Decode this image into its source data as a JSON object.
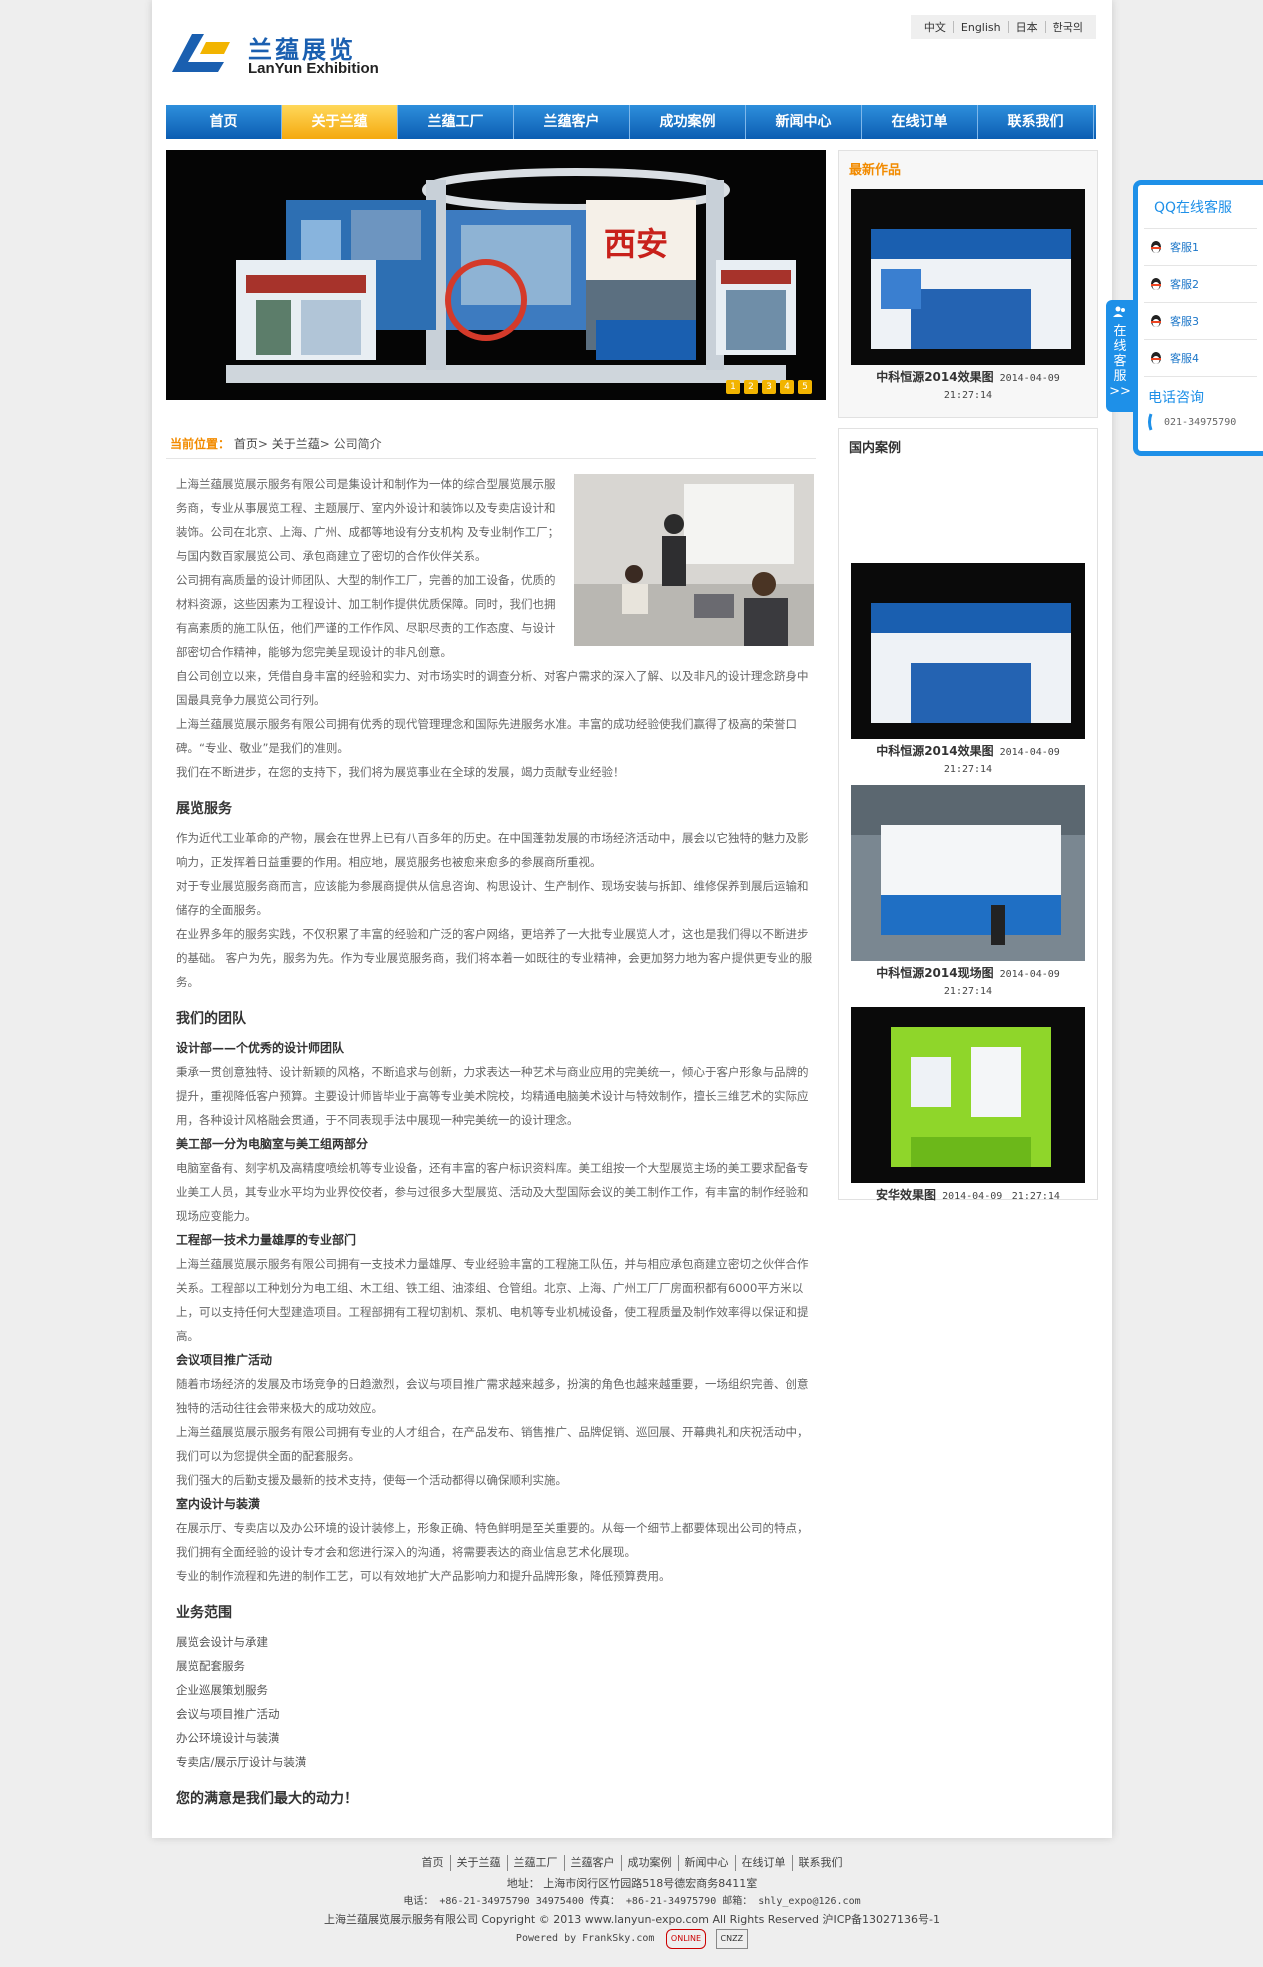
{
  "header": {
    "logo_cn": "兰蕴展览",
    "logo_en": "LanYun Exhibition",
    "languages": [
      "中文",
      "English",
      "日本",
      "한국의"
    ]
  },
  "nav": [
    "首页",
    "关于兰蕴",
    "兰蕴工厂",
    "兰蕴客户",
    "成功案例",
    "新闻中心",
    "在线订单",
    "联系我们"
  ],
  "banner": {
    "dots": [
      "1",
      "2",
      "3",
      "4",
      "5"
    ],
    "sign": "西安"
  },
  "latest": {
    "title": "最新作品",
    "item": {
      "name": "中科恒源2014效果图",
      "date": "2014-04-09",
      "time": "21:27:14"
    }
  },
  "domestic": {
    "title": "国内案例",
    "items": [
      {
        "name": "中科恒源2014效果图",
        "date": "2014-04-09",
        "time": "21:27:14"
      },
      {
        "name": "中科恒源2014现场图",
        "date": "2014-04-09",
        "time": "21:27:14"
      },
      {
        "name": "安华效果图",
        "date": "2014-04-09",
        "time": "21:27:14"
      }
    ]
  },
  "breadcrumb": {
    "label": "当前位置：",
    "items": [
      "首页",
      "关于兰蕴",
      "公司简介"
    ]
  },
  "content": {
    "intro": [
      "上海兰蕴展览展示服务有限公司是集设计和制作为一体的综合型展览展示服务商，专业从事展览工程、主题展厅、室内外设计和装饰以及专卖店设计和装饰。公司在北京、上海、广州、成都等地设有分支机构 及专业制作工厂；与国内数百家展览公司、承包商建立了密切的合作伙伴关系。",
      "公司拥有高质量的设计师团队、大型的制作工厂，完善的加工设备，优质的材料资源，这些因素为工程设计、加工制作提供优质保障。同时，我们也拥有高素质的施工队伍，他们严谨的工作作风、尽职尽责的工作态度、与设计部密切合作精神，能够为您完美呈现设计的非凡创意。",
      "自公司创立以来，凭借自身丰富的经验和实力、对市场实时的调查分析、对客户需求的深入了解、以及非凡的设计理念跻身中国最具竞争力展览公司行列。",
      "上海兰蕴展览展示服务有限公司拥有优秀的现代管理理念和国际先进服务水准。丰富的成功经验使我们赢得了极高的荣誉口碑。“专业、敬业”是我们的准则。",
      "我们在不断进步，在您的支持下，我们将为展览事业在全球的发展，竭力贡献专业经验！"
    ],
    "service_title": "展览服务",
    "service": [
      "作为近代工业革命的产物，展会在世界上已有八百多年的历史。在中国蓬勃发展的市场经济活动中，展会以它独特的魅力及影响力，正发挥着日益重要的作用。相应地，展览服务也被愈来愈多的参展商所重视。",
      "对于专业展览服务商而言，应该能为参展商提供从信息咨询、构思设计、生产制作、现场安装与拆卸、维修保养到展后运输和储存的全面服务。",
      "在业界多年的服务实践，不仅积累了丰富的经验和广泛的客户网络，更培养了一大批专业展览人才，这也是我们得以不断进步的基础。 客户为先，服务为先。作为专业展览服务商，我们将本着一如既往的专业精神，会更加努力地为客户提供更专业的服务。"
    ],
    "team_title": "我们的团队",
    "team": [
      {
        "h": "设计部——个优秀的设计师团队",
        "p": "秉承一贯创意独特、设计新颖的风格，不断追求与创新，力求表达一种艺术与商业应用的完美统一，倾心于客户形象与品牌的提升，重视降低客户预算。主要设计师皆毕业于高等专业美术院校，均精通电脑美术设计与特效制作，擅长三维艺术的实际应用，各种设计风格融会贯通，于不同表现手法中展现一种完美统一的设计理念。"
      },
      {
        "h": "美工部一分为电脑室与美工组两部分",
        "p": "电脑室备有、刻字机及高精度喷绘机等专业设备，还有丰富的客户标识资料库。美工组按一个大型展览主场的美工要求配备专业美工人员，其专业水平均为业界佼佼者，参与过很多大型展览、活动及大型国际会议的美工制作工作，有丰富的制作经验和现场应变能力。"
      },
      {
        "h": "工程部一技术力量雄厚的专业部门",
        "p": "上海兰蕴展览展示服务有限公司拥有一支技术力量雄厚、专业经验丰富的工程施工队伍，并与相应承包商建立密切之伙伴合作关系。工程部以工种划分为电工组、木工组、铁工组、油漆组、仓管组。北京、上海、广州工厂厂房面积都有6000平方米以上，可以支持任何大型建造项目。工程部拥有工程切割机、泵机、电机等专业机械设备，使工程质量及制作效率得以保证和提高。"
      },
      {
        "h": "会议项目推广活动",
        "p": "随着市场经济的发展及市场竞争的日趋激烈，会议与项目推广需求越来越多，扮演的角色也越来越重要，一场组织完善、创意独特的活动往往会带来极大的成功效应。"
      },
      {
        "h": "",
        "p": "上海兰蕴展览展示服务有限公司拥有专业的人才组合，在产品发布、销售推广、品牌促销、巡回展、开幕典礼和庆祝活动中，我们可以为您提供全面的配套服务。"
      },
      {
        "h": "",
        "p": "我们强大的后勤支援及最新的技术支持，使每一个活动都得以确保顺利实施。"
      },
      {
        "h": "室内设计与装潢",
        "p": "在展示厅、专卖店以及办公环境的设计装修上，形象正确、特色鲜明是至关重要的。从每一个细节上都要体现出公司的特点，我们拥有全面经验的设计专才会和您进行深入的沟通，将需要表达的商业信息艺术化展现。"
      },
      {
        "h": "",
        "p": "专业的制作流程和先进的制作工艺，可以有效地扩大产品影响力和提升品牌形象，降低预算费用。"
      }
    ],
    "scope_title": "业务范围",
    "scope": [
      "展览会设计与承建",
      "展览配套服务",
      "企业巡展策划服务",
      "会议与项目推广活动",
      "办公环境设计与装潢",
      "专卖店/展示厅设计与装潢"
    ],
    "motto": "您的满意是我们最大的动力！"
  },
  "qq": {
    "tab": "在线客服",
    "title": "QQ在线客服",
    "items": [
      "客服1",
      "客服2",
      "客服3",
      "客服4"
    ],
    "phone_title": "电话咨询",
    "phone": "021-34975790"
  },
  "footer": {
    "nav": [
      "首页",
      "关于兰蕴",
      "兰蕴工厂",
      "兰蕴客户",
      "成功案例",
      "新闻中心",
      "在线订单",
      "联系我们"
    ],
    "address": "地址： 上海市闵行区竹园路518号德宏商务8411室",
    "contact": "电话： +86-21-34975790  34975400   传真： +86-21-34975790    邮箱： shly_expo@126.com",
    "copyright": "上海兰蕴展览展示服务有限公司 Copyright © 2013 www.lanyun-expo.com All Rights Reserved  沪ICP备13027136号-1",
    "powered": "Powered by FrankSky.com",
    "badge1": "ONLINE",
    "badge2": "CNZZ"
  }
}
